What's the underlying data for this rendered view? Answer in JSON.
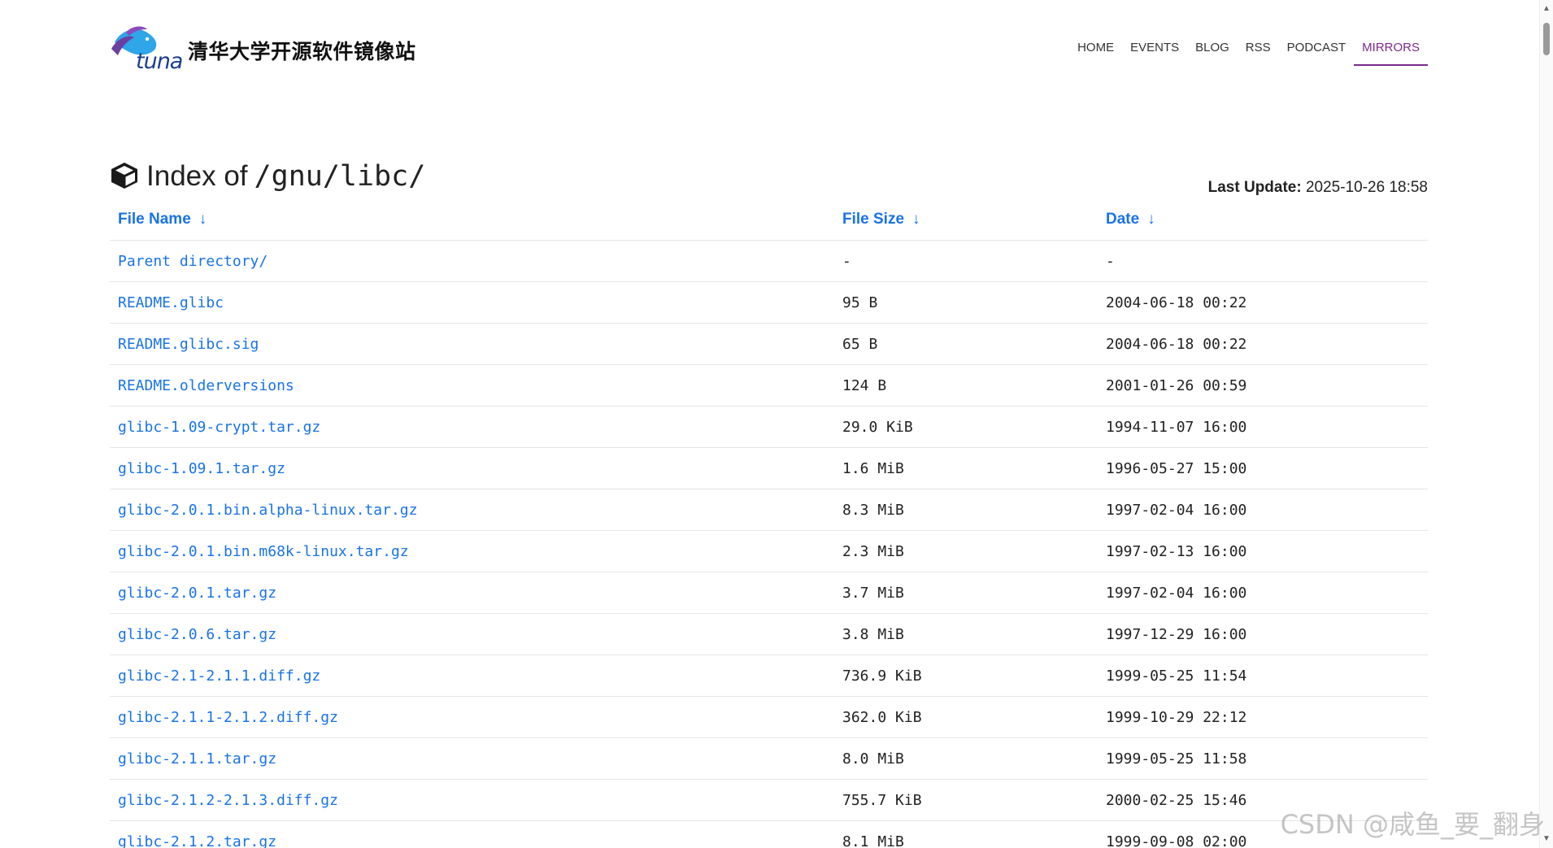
{
  "site": {
    "logo_text": "tuna",
    "title": "清华大学开源软件镜像站"
  },
  "nav": {
    "items": [
      {
        "label": "HOME",
        "active": false
      },
      {
        "label": "EVENTS",
        "active": false
      },
      {
        "label": "BLOG",
        "active": false
      },
      {
        "label": "RSS",
        "active": false
      },
      {
        "label": "PODCAST",
        "active": false
      },
      {
        "label": "MIRRORS",
        "active": true
      }
    ]
  },
  "index": {
    "label": "Index of",
    "path": "/gnu/libc/",
    "last_update_label": "Last Update:",
    "last_update_value": "2025-10-26 18:58"
  },
  "table": {
    "columns": [
      {
        "label": "File Name",
        "arrow": "↓"
      },
      {
        "label": "File Size",
        "arrow": "↓"
      },
      {
        "label": "Date",
        "arrow": "↓"
      }
    ],
    "rows": [
      {
        "name": "Parent directory/",
        "size": "-",
        "date": "-"
      },
      {
        "name": "README.glibc",
        "size": "95 B",
        "date": "2004-06-18 00:22"
      },
      {
        "name": "README.glibc.sig",
        "size": "65 B",
        "date": "2004-06-18 00:22"
      },
      {
        "name": "README.olderversions",
        "size": "124 B",
        "date": "2001-01-26 00:59"
      },
      {
        "name": "glibc-1.09-crypt.tar.gz",
        "size": "29.0 KiB",
        "date": "1994-11-07 16:00"
      },
      {
        "name": "glibc-1.09.1.tar.gz",
        "size": "1.6 MiB",
        "date": "1996-05-27 15:00"
      },
      {
        "name": "glibc-2.0.1.bin.alpha-linux.tar.gz",
        "size": "8.3 MiB",
        "date": "1997-02-04 16:00"
      },
      {
        "name": "glibc-2.0.1.bin.m68k-linux.tar.gz",
        "size": "2.3 MiB",
        "date": "1997-02-13 16:00"
      },
      {
        "name": "glibc-2.0.1.tar.gz",
        "size": "3.7 MiB",
        "date": "1997-02-04 16:00"
      },
      {
        "name": "glibc-2.0.6.tar.gz",
        "size": "3.8 MiB",
        "date": "1997-12-29 16:00"
      },
      {
        "name": "glibc-2.1-2.1.1.diff.gz",
        "size": "736.9 KiB",
        "date": "1999-05-25 11:54"
      },
      {
        "name": "glibc-2.1.1-2.1.2.diff.gz",
        "size": "362.0 KiB",
        "date": "1999-10-29 22:12"
      },
      {
        "name": "glibc-2.1.1.tar.gz",
        "size": "8.0 MiB",
        "date": "1999-05-25 11:58"
      },
      {
        "name": "glibc-2.1.2-2.1.3.diff.gz",
        "size": "755.7 KiB",
        "date": "2000-02-25 15:46"
      },
      {
        "name": "glibc-2.1.2.tar.gz",
        "size": "8.1 MiB",
        "date": "1999-09-08 02:00"
      }
    ]
  },
  "watermark": "CSDN @咸鱼_要_翻身",
  "colors": {
    "link": "#1a73e8",
    "active_nav": "#7b2a8c"
  }
}
